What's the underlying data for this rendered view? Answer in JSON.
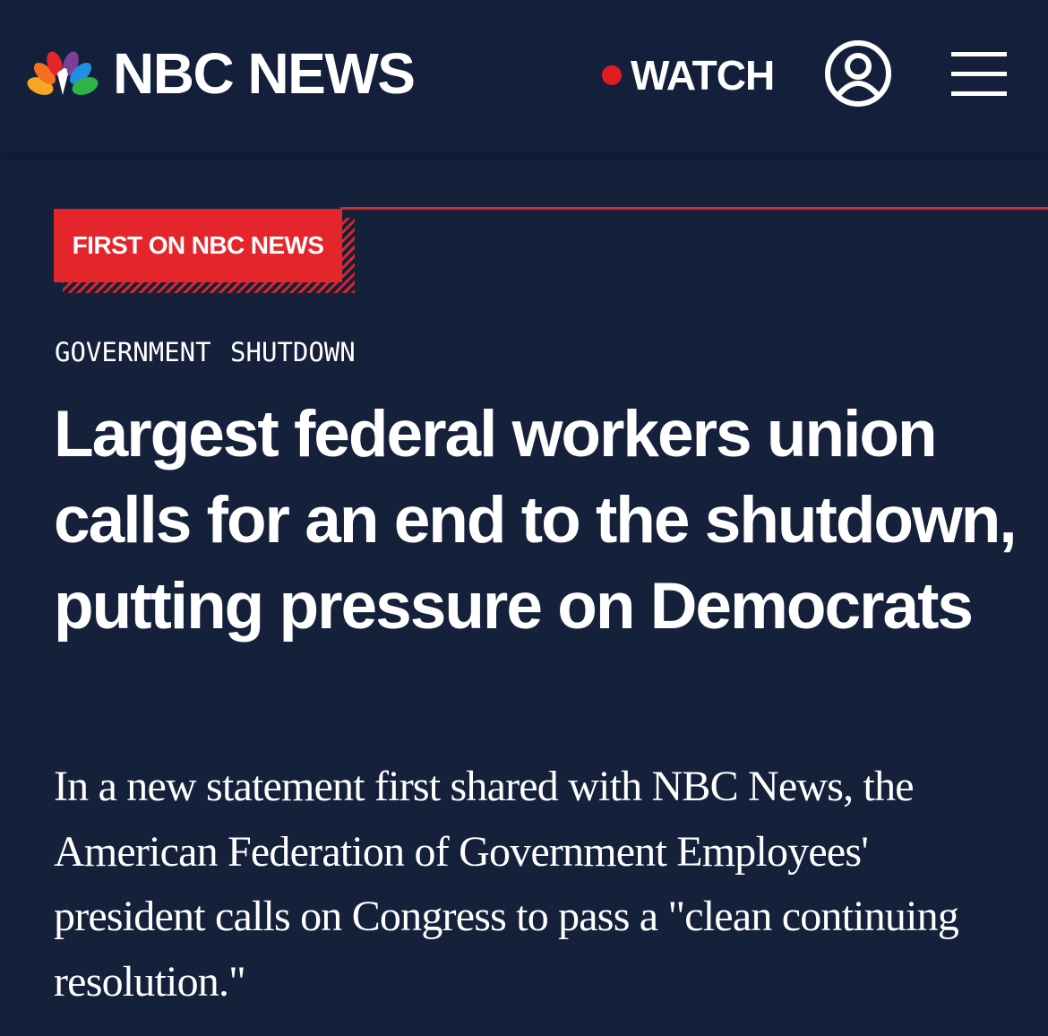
{
  "header": {
    "brand": "NBC NEWS",
    "watch_label": "WATCH",
    "icons": {
      "logo": "nbc-peacock-icon",
      "live": "live-dot-icon",
      "account": "user-account-icon",
      "menu": "hamburger-menu-icon"
    }
  },
  "article": {
    "tag": "FIRST ON NBC NEWS",
    "section": "GOVERNMENT SHUTDOWN",
    "headline": "Largest federal workers union calls for an end to the shutdown, putting pressure on Democrats",
    "dek": "In a new statement first shared with NBC News, the American Federation of Government Employees' president calls on Congress to pass a \"clean continuing resolution.\""
  },
  "colors": {
    "background": "#15203b",
    "accent_red": "#e4252b",
    "text": "#ffffff"
  }
}
